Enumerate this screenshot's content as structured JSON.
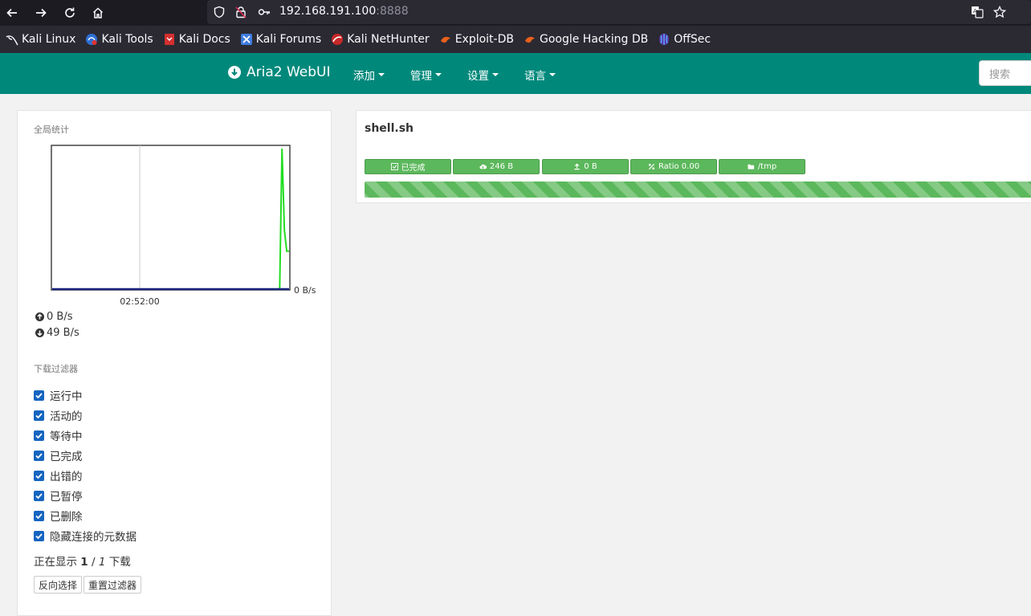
{
  "browser": {
    "url_host": "192.168.191.100",
    "url_port": ":8888",
    "bookmarks": [
      {
        "label": "Kali Linux",
        "icon": "kali-dragon-icon"
      },
      {
        "label": "Kali Tools",
        "icon": "kali-tools-icon"
      },
      {
        "label": "Kali Docs",
        "icon": "kali-docs-icon"
      },
      {
        "label": "Kali Forums",
        "icon": "kali-forums-icon"
      },
      {
        "label": "Kali NetHunter",
        "icon": "nethunter-icon"
      },
      {
        "label": "Exploit-DB",
        "icon": "exploit-db-icon"
      },
      {
        "label": "Google Hacking DB",
        "icon": "ghdb-icon"
      },
      {
        "label": "OffSec",
        "icon": "offsec-icon"
      }
    ]
  },
  "navbar": {
    "brand": "Aria2 WebUI",
    "menus": [
      "添加",
      "管理",
      "设置",
      "语言"
    ],
    "search_placeholder": "搜索",
    "bg_color": "#00897b"
  },
  "sidebar": {
    "stats_title": "全局统计",
    "chart_data": {
      "type": "line",
      "x_tick_labels": [
        "02:52:00"
      ],
      "y_tick_labels": [
        "0 B/s"
      ],
      "series": [
        {
          "color": "#22dd22",
          "values": [
            0,
            0,
            0,
            0,
            0,
            0,
            0,
            0,
            0,
            0,
            0,
            0,
            0,
            0,
            0,
            0,
            0,
            0,
            0,
            0,
            0,
            0,
            0,
            0,
            0,
            0,
            0,
            0,
            0,
            0,
            0,
            0,
            0,
            0,
            0,
            0,
            0,
            0,
            0,
            0,
            0,
            0,
            0,
            0,
            0,
            0,
            0,
            0,
            0,
            0,
            0,
            0,
            0,
            0,
            0,
            0,
            0,
            0,
            0,
            0,
            0,
            0,
            0,
            0,
            0,
            0,
            0,
            0,
            0,
            0,
            0,
            0,
            0,
            0,
            0,
            0,
            0,
            0,
            0,
            0,
            0,
            0,
            0,
            0,
            0,
            0,
            0,
            0,
            0,
            0,
            0,
            0,
            0,
            0,
            0,
            0,
            0,
            0,
            1.0,
            0.42,
            0.27,
            0.27
          ]
        },
        {
          "color": "#1a237e",
          "values": [
            0,
            0,
            0,
            0,
            0,
            0,
            0,
            0,
            0,
            0,
            0,
            0,
            0,
            0,
            0,
            0,
            0,
            0,
            0,
            0,
            0,
            0,
            0,
            0,
            0,
            0,
            0,
            0,
            0,
            0,
            0,
            0,
            0,
            0,
            0,
            0,
            0,
            0,
            0,
            0,
            0,
            0,
            0,
            0,
            0,
            0,
            0,
            0,
            0,
            0,
            0,
            0,
            0,
            0,
            0,
            0,
            0,
            0,
            0,
            0,
            0,
            0,
            0,
            0,
            0,
            0,
            0,
            0,
            0,
            0,
            0,
            0,
            0,
            0,
            0,
            0,
            0,
            0,
            0,
            0,
            0,
            0,
            0,
            0,
            0,
            0,
            0,
            0,
            0,
            0,
            0,
            0,
            0,
            0,
            0,
            0,
            0,
            0,
            0,
            0,
            0,
            0
          ]
        }
      ],
      "grid": true
    },
    "upload_speed": "0 B/s",
    "download_speed": "49 B/s",
    "filter_title": "下载过滤器",
    "filters": [
      {
        "label": "运行中",
        "checked": true
      },
      {
        "label": "活动的",
        "checked": true
      },
      {
        "label": "等待中",
        "checked": true
      },
      {
        "label": "已完成",
        "checked": true
      },
      {
        "label": "出错的",
        "checked": true
      },
      {
        "label": "已暂停",
        "checked": true
      },
      {
        "label": "已删除",
        "checked": true
      },
      {
        "label": "隐藏连接的元数据",
        "checked": true
      }
    ],
    "showing_prefix": "正在显示",
    "showing_count": "1",
    "showing_sep": "/",
    "showing_total": "1",
    "showing_suffix": "下载",
    "invert_button": "反向选择",
    "reset_button": "重置过滤器"
  },
  "download": {
    "name": "shell.sh",
    "status": "已完成",
    "downloaded": "246 B",
    "uploaded": "0 B",
    "ratio": "Ratio 0.00",
    "dir": "/tmp",
    "progress": 1.0,
    "badge_color": "#5cb85c"
  }
}
